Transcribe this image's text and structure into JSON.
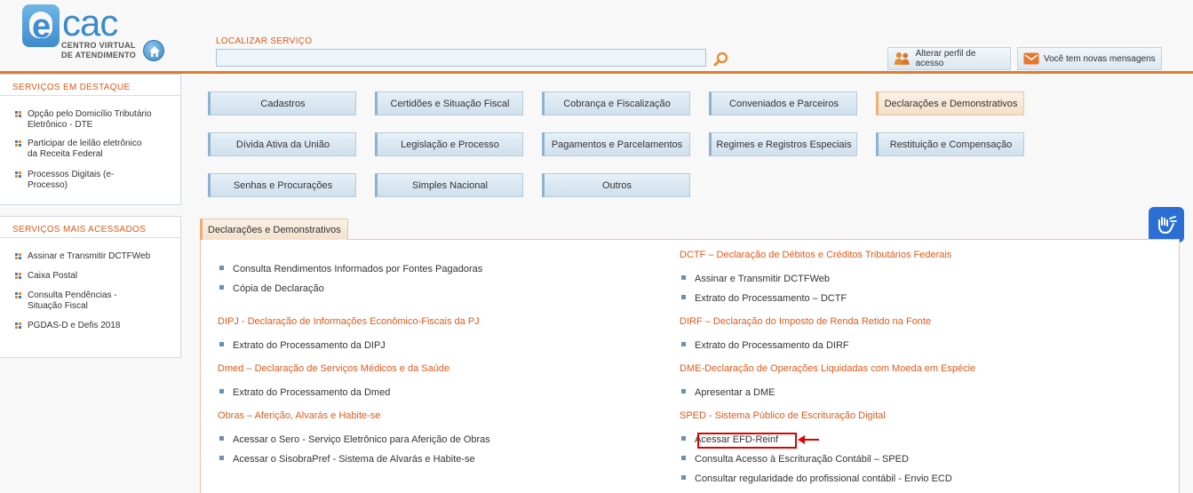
{
  "header": {
    "logo": {
      "brand": "cac",
      "subtitle_line1": "CENTRO VIRTUAL",
      "subtitle_line2": "DE ATENDIMENTO"
    },
    "search": {
      "label": "LOCALIZAR SERVIÇO",
      "value": "",
      "placeholder": ""
    },
    "profile_button": "Alterar perfil de acesso",
    "messages_button": "Você tem novas mensagens"
  },
  "sidebar": {
    "destaque": {
      "title": "SERVIÇOS EM DESTAQUE",
      "items": [
        {
          "l1": "Opção pelo Domicílio Tributário",
          "l2": "Eletrônico - DTE"
        },
        {
          "l1": "Participar de leilão eletrônico",
          "l2": "da Receita Federal"
        },
        {
          "l1": "Processos Digitais (e-",
          "l2": "Processo)"
        }
      ]
    },
    "mais": {
      "title": "SERVIÇOS MAIS ACESSADOS",
      "items": [
        {
          "l1": "Assinar e Transmitir DCTFWeb",
          "l2": ""
        },
        {
          "l1": "Caixa Postal",
          "l2": ""
        },
        {
          "l1": "Consulta Pendências -",
          "l2": "Situação Fiscal"
        },
        {
          "l1": "PGDAS-D e Defis 2018",
          "l2": ""
        }
      ]
    }
  },
  "categories": [
    "Cadastros",
    "Certidões e Situação Fiscal",
    "Cobrança e Fiscalização",
    "Conveniados e Parceiros",
    "Declarações e Demonstrativos",
    "Dívida Ativa da União",
    "Legislação e Processo",
    "Pagamentos e Parcelamentos",
    "Regimes e Registros Especiais",
    "Restituição e Compensação",
    "Senhas e Procurações",
    "Simples Nacional",
    "Outros"
  ],
  "active_category": "Declarações e Demonstrativos",
  "panel": {
    "tab": "Declarações e Demonstrativos",
    "left": {
      "top_links": [
        "Consulta Rendimentos Informados por Fontes Pagadoras",
        "Cópia de Declaração"
      ],
      "dipj": {
        "title": "DIPJ - Declaração de Informações Econômico-Fiscais da PJ",
        "links": [
          "Extrato do Processamento da DIPJ"
        ]
      },
      "dmed": {
        "title": "Dmed – Declaração de Serviços Médicos e da Saúde",
        "links": [
          "Extrato do Processamento da Dmed"
        ]
      },
      "obras": {
        "title": "Obras – Aferição, Alvarás e Habite-se",
        "links": [
          "Acessar o Sero - Serviço Eletrônico para Aferição de Obras",
          "Acessar o SisobraPref - Sistema de Alvarás e Habite-se"
        ]
      }
    },
    "right": {
      "dctf": {
        "title": "DCTF – Declaração de Débitos e Créditos Tributários Federais",
        "links": [
          "Assinar e Transmitir DCTFWeb",
          "Extrato do Processamento – DCTF"
        ]
      },
      "dirf": {
        "title": "DIRF – Declaração do Imposto de Renda Retido na Fonte",
        "links": [
          "Extrato do Processamento da DIRF"
        ]
      },
      "dme": {
        "title": "DME-Declaração de Operações Liquidadas com Moeda em Espécie",
        "links": [
          "Apresentar a DME"
        ]
      },
      "sped": {
        "title": "SPED - Sistema Público de Escrituração Digital",
        "links": [
          "Acessar EFD-Reinf",
          "Consulta Acesso à Escrituração Contábil – SPED",
          "Consultar regularidade do profissional contábil - Envio ECD"
        ]
      }
    }
  },
  "colors": {
    "accent_orange": "#e05a1a",
    "highlight_red": "#e00000",
    "link_blue": "#3b8bc9"
  },
  "icons": [
    "home-icon",
    "search-icon",
    "people-icon",
    "envelope-icon",
    "sign-language-icon",
    "arrow-left-icon"
  ]
}
